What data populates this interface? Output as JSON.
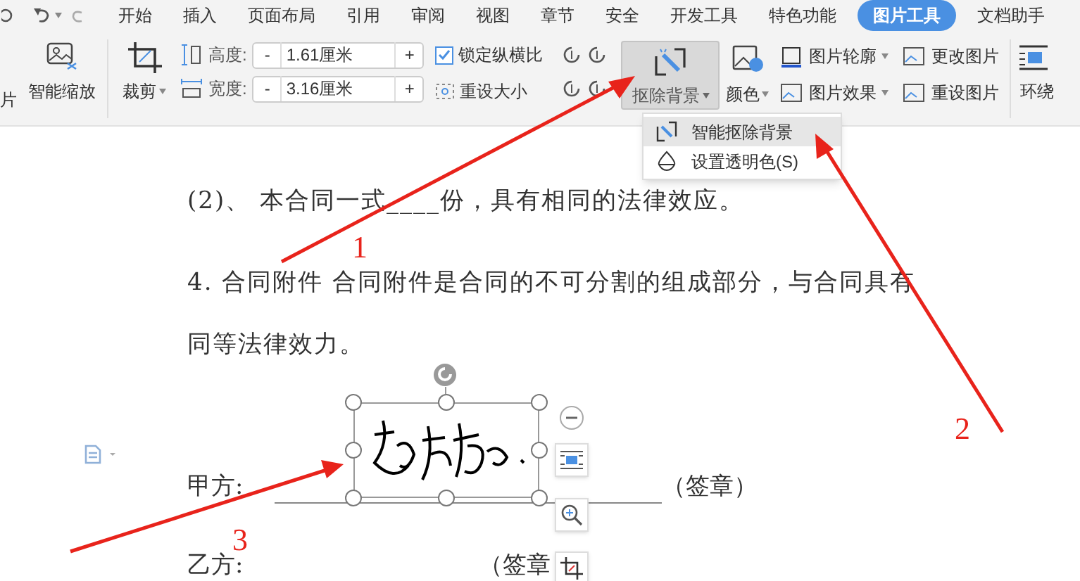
{
  "tabs": [
    {
      "label": "开始",
      "selected": false
    },
    {
      "label": "插入",
      "selected": false
    },
    {
      "label": "页面布局",
      "selected": false
    },
    {
      "label": "引用",
      "selected": false
    },
    {
      "label": "审阅",
      "selected": false
    },
    {
      "label": "视图",
      "selected": false
    },
    {
      "label": "章节",
      "selected": false
    },
    {
      "label": "安全",
      "selected": false
    },
    {
      "label": "开发工具",
      "selected": false
    },
    {
      "label": "特色功能",
      "selected": false
    },
    {
      "label": "图片工具",
      "selected": true
    },
    {
      "label": "文档助手",
      "selected": false
    }
  ],
  "ribbon": {
    "cut_label": "片",
    "smart_zoom": "智能缩放",
    "crop": "裁剪",
    "height": {
      "label": "高度:",
      "minus": "-",
      "value": "1.61厘米",
      "plus": "+"
    },
    "width": {
      "label": "宽度:",
      "minus": "-",
      "value": "3.16厘米",
      "plus": "+"
    },
    "lock_ratio": {
      "label": "锁定纵横比",
      "checked": true
    },
    "reset_size": "重设大小",
    "remove_background": {
      "label": "抠除背景",
      "pressed": true
    },
    "color_label": "颜色",
    "outline": "图片轮廓",
    "effects": "图片效果",
    "change_picture": "更改图片",
    "reset_picture": "重设图片",
    "wrap": "环绕"
  },
  "dropdown": [
    {
      "label": "智能抠除背景",
      "selected": true
    },
    {
      "label": "设置透明色(S)",
      "selected": false
    }
  ],
  "document": {
    "paragraphs": [
      "(2)、  本合同一式____份，具有相同的法律效应。",
      "4. 合同附件  合同附件是合同的不可分割的组成部分，与合同具有",
      "同等法律效力。"
    ],
    "party_a": "甲方:",
    "party_a_seal": "（签章）",
    "party_b": "乙方:",
    "party_b_seal": "（签章"
  },
  "annotations": [
    "1",
    "2",
    "3"
  ]
}
